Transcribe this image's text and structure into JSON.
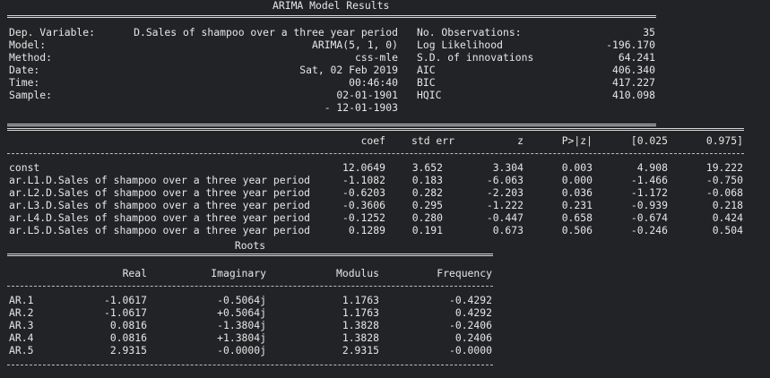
{
  "arima": {
    "title": "ARIMA Model Results",
    "info_left": [
      {
        "label": "Dep. Variable:",
        "value": "D.Sales of shampoo over a three year period"
      },
      {
        "label": "Model:",
        "value": "ARIMA(5, 1, 0)"
      },
      {
        "label": "Method:",
        "value": "css-mle"
      },
      {
        "label": "Date:",
        "value": "Sat, 02 Feb 2019"
      },
      {
        "label": "Time:",
        "value": "00:46:40"
      },
      {
        "label": "Sample:",
        "value": "02-01-1901"
      },
      {
        "label": "",
        "value": "- 12-01-1903"
      }
    ],
    "info_right": [
      {
        "label": "No. Observations:",
        "value": "35"
      },
      {
        "label": "Log Likelihood",
        "value": "-196.170"
      },
      {
        "label": "S.D. of innovations",
        "value": "64.241"
      },
      {
        "label": "AIC",
        "value": "406.340"
      },
      {
        "label": "BIC",
        "value": "417.227"
      },
      {
        "label": "HQIC",
        "value": "410.098"
      }
    ]
  },
  "coef_table": {
    "headers": [
      "coef",
      "std err",
      "z",
      "P>|z|",
      "[0.025",
      "0.975]"
    ],
    "rows": [
      {
        "name": "const",
        "vals": [
          "12.0649",
          "3.652",
          "3.304",
          "0.003",
          "4.908",
          "19.222"
        ]
      },
      {
        "name": "ar.L1.D.Sales of shampoo over a three year period",
        "vals": [
          "-1.1082",
          "0.183",
          "-6.063",
          "0.000",
          "-1.466",
          "-0.750"
        ]
      },
      {
        "name": "ar.L2.D.Sales of shampoo over a three year period",
        "vals": [
          "-0.6203",
          "0.282",
          "-2.203",
          "0.036",
          "-1.172",
          "-0.068"
        ]
      },
      {
        "name": "ar.L3.D.Sales of shampoo over a three year period",
        "vals": [
          "-0.3606",
          "0.295",
          "-1.222",
          "0.231",
          "-0.939",
          "0.218"
        ]
      },
      {
        "name": "ar.L4.D.Sales of shampoo over a three year period",
        "vals": [
          "-0.1252",
          "0.280",
          "-0.447",
          "0.658",
          "-0.674",
          "0.424"
        ]
      },
      {
        "name": "ar.L5.D.Sales of shampoo over a three year period",
        "vals": [
          "0.1289",
          "0.191",
          "0.673",
          "0.506",
          "-0.246",
          "0.504"
        ]
      }
    ]
  },
  "roots": {
    "title": "Roots",
    "headers": [
      "Real",
      "Imaginary",
      "Modulus",
      "Frequency"
    ],
    "rows": [
      {
        "name": "AR.1",
        "vals": [
          "-1.0617",
          "-0.5064j",
          "1.1763",
          "-0.4292"
        ]
      },
      {
        "name": "AR.2",
        "vals": [
          "-1.0617",
          "+0.5064j",
          "1.1763",
          "0.4292"
        ]
      },
      {
        "name": "AR.3",
        "vals": [
          "0.0816",
          "-1.3804j",
          "1.3828",
          "-0.2406"
        ]
      },
      {
        "name": "AR.4",
        "vals": [
          "0.0816",
          "+1.3804j",
          "1.3828",
          "0.2406"
        ]
      },
      {
        "name": "AR.5",
        "vals": [
          "2.9315",
          "-0.0000j",
          "2.9315",
          "-0.0000"
        ]
      }
    ]
  }
}
